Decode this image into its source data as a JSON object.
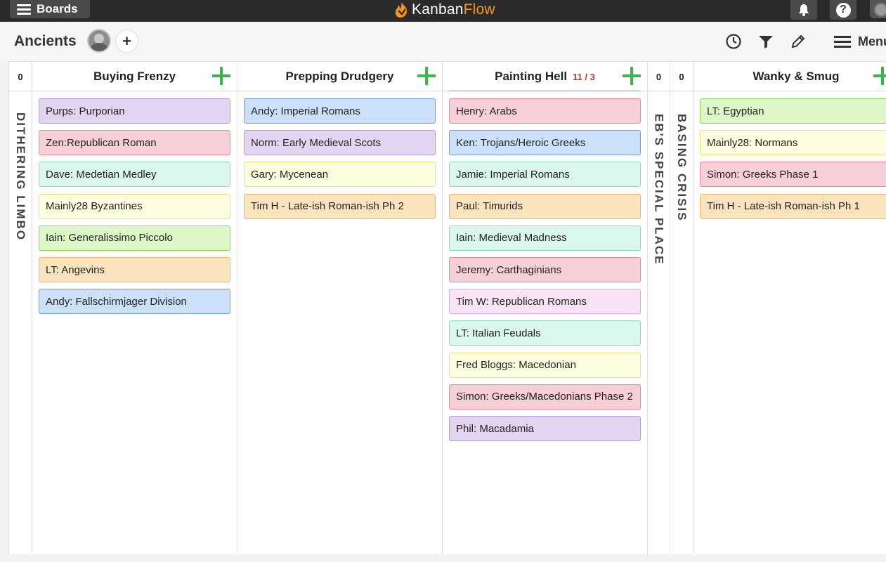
{
  "topbar": {
    "boards_label": "Boards",
    "logo_text_1": "Kanban",
    "logo_text_2": "Flow"
  },
  "board": {
    "title": "Ancients",
    "menu_label": "Menu"
  },
  "colors": {
    "purple": "#e3d4f2",
    "red": "#f7cfd7",
    "mint": "#d9f7ec",
    "yellow": "#fdfde0",
    "green": "#ddf7c9",
    "orange": "#fbe3bd",
    "blue": "#cde0f9",
    "pink": "#fbe3f7"
  },
  "columns": {
    "dithering": {
      "count": "0",
      "label": "DITHERING LIMBO"
    },
    "buying": {
      "title": "Buying Frenzy",
      "tasks": [
        {
          "text": "Purps: Purporian",
          "color": "purple"
        },
        {
          "text": "Zen:Republican Roman",
          "color": "red"
        },
        {
          "text": "Dave: Medetian Medley",
          "color": "mint"
        },
        {
          "text": "Mainly28 Byzantines",
          "color": "yellow"
        },
        {
          "text": "Iain: Generalissimo Piccolo",
          "color": "green"
        },
        {
          "text": "LT: Angevins",
          "color": "orange"
        },
        {
          "text": "Andy: Fallschirmjager Division",
          "color": "blue"
        }
      ]
    },
    "prepping": {
      "title": "Prepping Drudgery",
      "tasks": [
        {
          "text": "Andy: Imperial Romans",
          "color": "blue"
        },
        {
          "text": "Norm: Early Medieval Scots",
          "color": "purple"
        },
        {
          "text": "Gary: Mycenean",
          "color": "yellow"
        },
        {
          "text": "Tim H - Late-ish Roman-ish Ph 2",
          "color": "orange"
        }
      ]
    },
    "painting": {
      "title": "Painting Hell",
      "wip": "11 / 3",
      "tasks": [
        {
          "text": "Henry: Arabs",
          "color": "red"
        },
        {
          "text": "Ken: Trojans/Heroic Greeks",
          "color": "blue"
        },
        {
          "text": "Jamie: Imperial Romans",
          "color": "mint"
        },
        {
          "text": "Paul: Timurids",
          "color": "orange"
        },
        {
          "text": "Iain: Medieval Madness",
          "color": "mint"
        },
        {
          "text": "Jeremy: Carthaginians",
          "color": "red"
        },
        {
          "text": "Tim W: Republican Romans",
          "color": "pink"
        },
        {
          "text": "LT: Italian Feudals",
          "color": "mint"
        },
        {
          "text": "Fred Bloggs: Macedonian",
          "color": "yellow"
        },
        {
          "text": "Simon: Greeks/Macedonians Phase 2",
          "color": "red"
        },
        {
          "text": "Phil: Macadamia",
          "color": "purple"
        }
      ]
    },
    "ebs": {
      "count": "0",
      "label": "EB'S SPECIAL PLACE"
    },
    "basing": {
      "count": "0",
      "label": "BASING CRISIS"
    },
    "wanky": {
      "title": "Wanky & Smug",
      "tasks": [
        {
          "text": "LT: Egyptian",
          "color": "green"
        },
        {
          "text": "Mainly28: Normans",
          "color": "yellow"
        },
        {
          "text": "Simon: Greeks Phase 1",
          "color": "red"
        },
        {
          "text": "Tim H - Late-ish Roman-ish Ph 1",
          "color": "orange"
        }
      ]
    }
  }
}
